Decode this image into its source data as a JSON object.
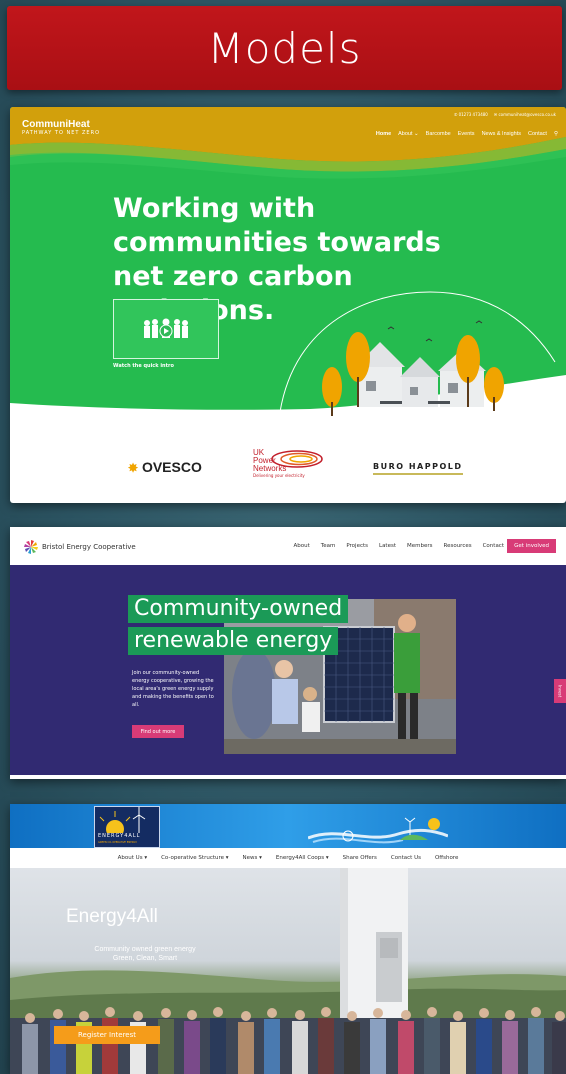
{
  "slide": {
    "title": "Models"
  },
  "communiheat": {
    "logo_name": "CommuniHeat",
    "logo_tagline": "PATHWAY TO NET ZERO",
    "phone": "01273 473480",
    "email": "communiheat@ovesco.co.uk",
    "nav": [
      "Home",
      "About",
      "Barcombe",
      "Events",
      "News & Insights",
      "Contact"
    ],
    "heading": "Working with communities towards net zero carbon emissions.",
    "video_label": "Watch the quick intro",
    "partners": {
      "ovesco": "OVESCO",
      "ukpn_line1": "UK",
      "ukpn_line2": "Power",
      "ukpn_line3": "Networks",
      "ukpn_tagline": "Delivering your electricity",
      "buro": "BURO HAPPOLD"
    },
    "colors": {
      "hero": "#25bb4f",
      "header": "#d2a00c"
    }
  },
  "bristol": {
    "logo_name": "Bristol Energy Cooperative",
    "nav": [
      "About",
      "Team",
      "Projects",
      "Latest",
      "Members",
      "Resources",
      "Contact"
    ],
    "cta": "Get involved",
    "heading_line1": "Community-owned",
    "heading_line2": "renewable energy",
    "body": "Join our community-owned energy cooperative, growing the local area's green energy supply and making the benefits open to all.",
    "button": "Find out more",
    "side_tab": "Invest",
    "colors": {
      "hero": "#312a72",
      "accent": "#d83b77",
      "highlight": "#1b9a57"
    }
  },
  "energy4all": {
    "logo_name": "ENERGY4ALL",
    "logo_sub": "GREEN CO-OPERATIVE ENERGY",
    "nav": [
      "About Us ▾",
      "Co-operative Structure ▾",
      "News ▾",
      "Energy4All Coops ▾",
      "Share Offers",
      "Contact Us",
      "Offshore"
    ],
    "title": "Energy4All",
    "subtitle_line1": "Community owned green energy",
    "subtitle_line2": "Green, Clean, Smart",
    "button": "Register Interest",
    "colors": {
      "banner": "#1a82d6",
      "button": "#f59c1a"
    }
  }
}
